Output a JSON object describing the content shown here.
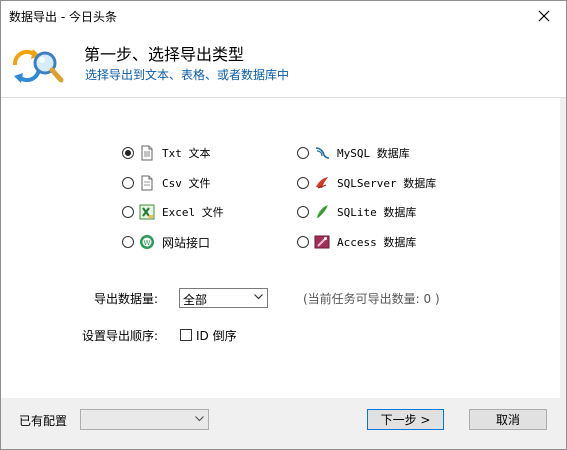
{
  "window": {
    "title": "数据导出 - 今日头条"
  },
  "header": {
    "title": "第一步、选择导出类型",
    "subtitle": "选择导出到文本、表格、或者数据库中"
  },
  "export_types": [
    {
      "label": "Txt 文本",
      "checked": true,
      "icon": "text-file-icon"
    },
    {
      "label": "Csv 文件",
      "checked": false,
      "icon": "csv-file-icon"
    },
    {
      "label": "Excel 文件",
      "checked": false,
      "icon": "excel-icon"
    },
    {
      "label": "网站接口",
      "checked": false,
      "icon": "web-api-icon"
    },
    {
      "label": "MySQL 数据库",
      "checked": false,
      "icon": "mysql-icon"
    },
    {
      "label": "SQLServer 数据库",
      "checked": false,
      "icon": "sqlserver-icon"
    },
    {
      "label": "SQLite 数据库",
      "checked": false,
      "icon": "sqlite-icon"
    },
    {
      "label": "Access 数据库",
      "checked": false,
      "icon": "access-icon"
    }
  ],
  "amount": {
    "label": "导出数据量:",
    "value": "全部",
    "hint": "(当前任务可导出数量: 0 )"
  },
  "order": {
    "label": "设置导出顺序:",
    "checkbox_label": "ID 倒序",
    "checked": false
  },
  "footer": {
    "config_label": "已有配置",
    "config_value": "",
    "next_label": "下一步 >",
    "cancel_label": "取消"
  },
  "colors": {
    "subtitle": "#0b5ca8",
    "primary_border": "#0078d7"
  }
}
